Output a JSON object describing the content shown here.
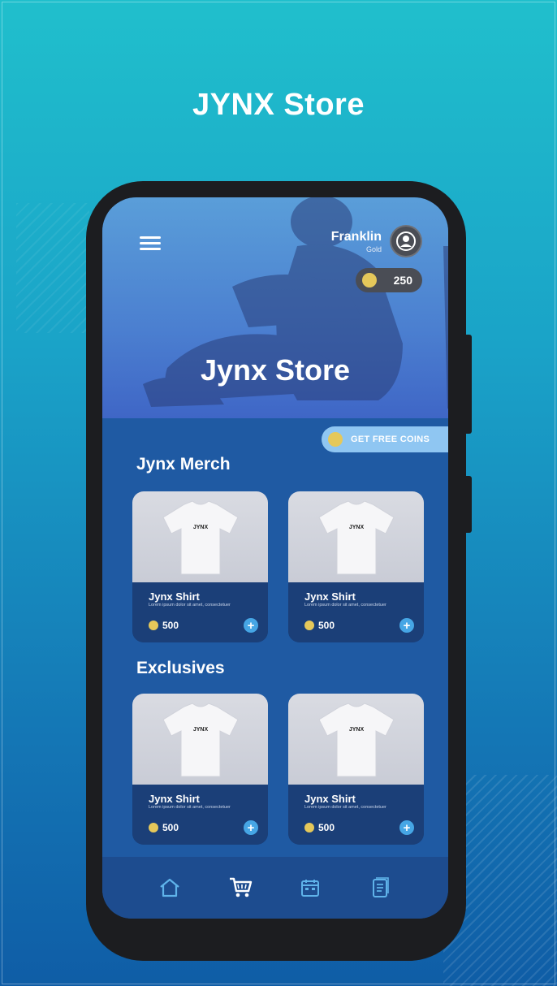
{
  "page": {
    "title": "JYNX Store"
  },
  "user": {
    "name": "Franklin",
    "tier": "Gold",
    "coins": "250"
  },
  "hero": {
    "title": "Jynx Store"
  },
  "promo": {
    "free_coins_label": "GET FREE COINS"
  },
  "sections": [
    {
      "title": "Jynx Merch",
      "items": [
        {
          "name": "Jynx Shirt",
          "description": "Lorem ipsum dolor sit amet, consectetuer",
          "price": "500",
          "logo": "JYNX"
        },
        {
          "name": "Jynx Shirt",
          "description": "Lorem ipsum dolor sit amet, consectetuer",
          "price": "500",
          "logo": "JYNX"
        }
      ]
    },
    {
      "title": "Exclusives",
      "items": [
        {
          "name": "Jynx Shirt",
          "description": "Lorem ipsum dolor sit amet, consectetuer",
          "price": "500",
          "logo": "JYNX"
        },
        {
          "name": "Jynx Shirt",
          "description": "Lorem ipsum dolor sit amet, consectetuer",
          "price": "500",
          "logo": "JYNX"
        }
      ]
    }
  ],
  "nav": [
    "home-icon",
    "cart-icon",
    "calendar-icon",
    "document-icon"
  ],
  "colors": {
    "accent": "#46a6e5",
    "coin": "#e5c85a",
    "screen_bg": "#1f5aa3"
  }
}
